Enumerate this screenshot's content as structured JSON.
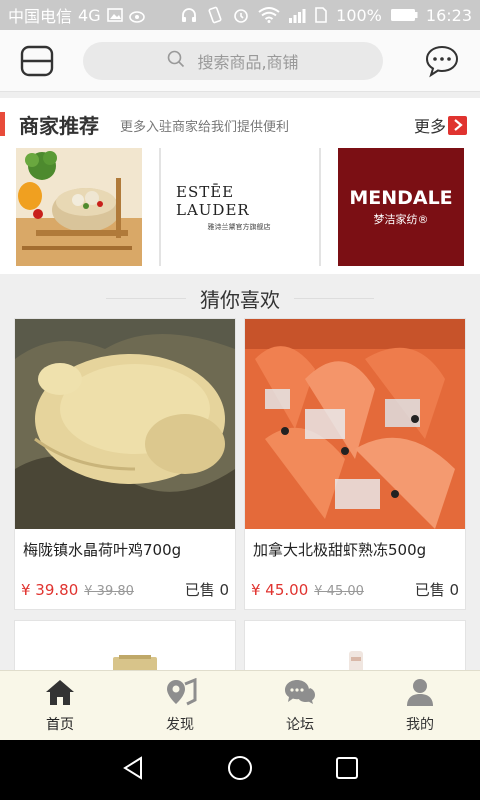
{
  "status_bar": {
    "carrier": "中国电信",
    "network": "4G",
    "battery_text": "100%",
    "time": "16:23"
  },
  "top_bar": {
    "menu_icon": "menu-icon",
    "search_placeholder": "搜索商品,商铺",
    "chat_icon": "chat-bubble-icon"
  },
  "merchants": {
    "title": "商家推荐",
    "subtitle": "更多入驻商家给我们提供便利",
    "more_label": "更多",
    "logos": [
      {
        "type": "food-photo"
      },
      {
        "brand": "ESTĒE LAUDER",
        "sub": "雅诗兰黛官方旗舰店"
      },
      {
        "brand": "MENDALE",
        "sub": "梦洁家纺®"
      }
    ]
  },
  "guess": {
    "title": "猜你喜欢",
    "products": [
      {
        "name": "梅陇镇水晶荷叶鸡700g",
        "price": "¥ 39.80",
        "old_price": "¥ 39.80",
        "sold": "已售 0"
      },
      {
        "name": "加拿大北极甜虾熟冻500g",
        "price": "¥ 45.00",
        "old_price": "¥ 45.00",
        "sold": "已售 0"
      }
    ]
  },
  "bottom_nav": {
    "items": [
      {
        "label": "首页",
        "icon": "home-icon"
      },
      {
        "label": "发现",
        "icon": "location-pin-icon"
      },
      {
        "label": "论坛",
        "icon": "forum-icon"
      },
      {
        "label": "我的",
        "icon": "user-icon"
      }
    ]
  },
  "colors": {
    "accent_red": "#e0332f",
    "nav_bg": "#f9f7e8",
    "status_bar": "#c9c9c9"
  }
}
